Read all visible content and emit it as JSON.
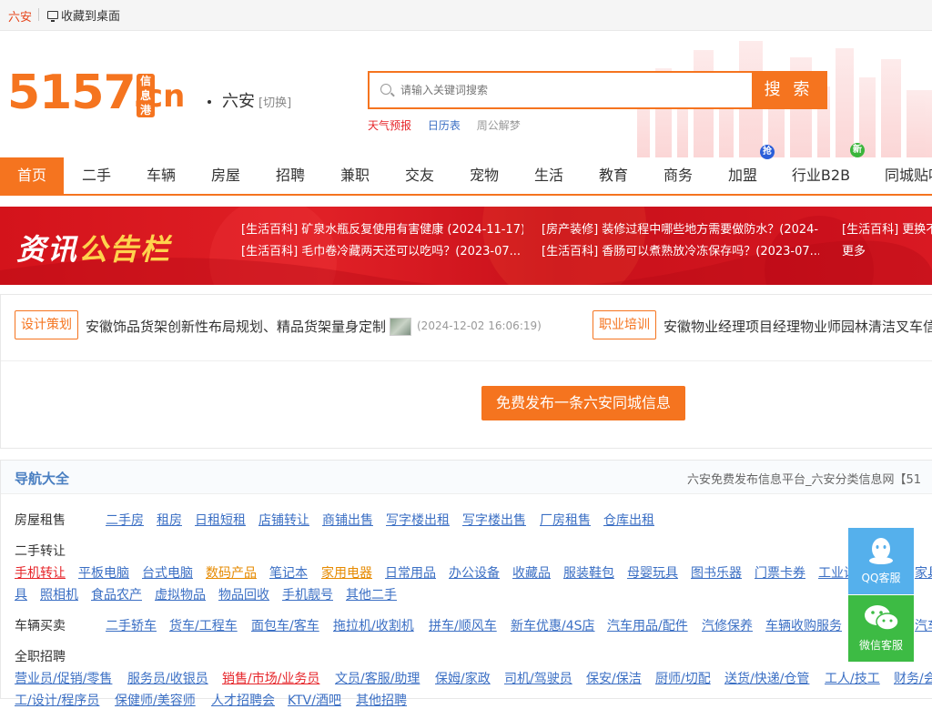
{
  "topbar": {
    "city": "六安",
    "favorite": "收藏到桌面"
  },
  "logo": {
    "number": "5157",
    "suffix": ".cn",
    "badge": "信息港"
  },
  "location": {
    "city": "六安",
    "switch": "[切换]"
  },
  "search": {
    "placeholder": "请输入关键词搜索",
    "button": "搜 索"
  },
  "quick_links": [
    {
      "label": "天气预报",
      "color": "#e6252a"
    },
    {
      "label": "日历表",
      "color": "#3b6fc4"
    },
    {
      "label": "周公解梦",
      "color": "#999999"
    }
  ],
  "nav": {
    "items": [
      "首页",
      "二手",
      "车辆",
      "房屋",
      "招聘",
      "兼职",
      "交友",
      "宠物",
      "生活",
      "教育",
      "商务",
      "加盟",
      "行业B2B",
      "同城贴吧"
    ],
    "tags": {
      "pin": "抢",
      "new": "新"
    }
  },
  "banner": {
    "title_a": "资讯",
    "title_b": "公告栏",
    "news": [
      "[生活百科] 矿泉水瓶反复使用有害健康 (2024-11-17)",
      "[房产装修] 装修过程中哪些地方需要做防水？(2024-...",
      "[生活百科] 更换不",
      "[生活百科] 毛巾卷冷藏两天还可以吃吗？(2023-07...",
      "[生活百科] 香肠可以煮熟放冷冻保存吗？(2023-07...",
      "更多"
    ]
  },
  "ads": [
    {
      "tag": "设计策划",
      "text": "安徽饰品货架创新性布局规划、精品货架量身定制",
      "date": "(2024-12-02 16:06:19)"
    },
    {
      "tag": "职业培训",
      "text": "安徽物业经理项目经理物业师园林清洁叉车信"
    }
  ],
  "publish_button": "免费发布一条六安同城信息",
  "nav_all": {
    "title": "导航大全",
    "subtitle": "六安免费发布信息平台_六安分类信息网【51",
    "rows": [
      {
        "cat": "房屋租售",
        "links": [
          "二手房",
          "租房",
          "日租短租",
          "店铺转让",
          "商铺出售",
          "写字楼出租",
          "写字楼出售",
          "厂房租售",
          "仓库出租"
        ]
      },
      {
        "cat": "二手转让",
        "links": [
          "手机转让",
          "平板电脑",
          "台式电脑",
          "数码产品",
          "笔记本",
          "家用电器",
          "日常用品",
          "办公设备",
          "收藏品",
          "服装鞋包",
          "母婴玩具",
          "图书乐器",
          "门票卡券",
          "工业设",
          "家具",
          "具",
          "照相机",
          "食品农产",
          "虚拟物品",
          "物品回收",
          "手机靓号",
          "其他二手"
        ]
      },
      {
        "cat": "车辆买卖",
        "links": [
          "二手轿车",
          "货车/工程车",
          "面包车/客车",
          "拖拉机/收割机",
          "拼车/顺风车",
          "新车优惠/4S店",
          "汽车用品/配件",
          "汽修保养",
          "车辆收购服务",
          "汽车"
        ]
      },
      {
        "cat": "全职招聘",
        "links": [
          "营业员/促销/零售",
          "服务员/收银员",
          "销售/市场/业务员",
          "文员/客服/助理",
          "保姆/家政",
          "司机/驾驶员",
          "保安/保洁",
          "厨师/切配",
          "送货/快递/仓管",
          "工人/技工",
          "财务/会",
          "工/设计/程序员",
          "保健师/美容师",
          "人才招聘会",
          "KTV/酒吧",
          "其他招聘"
        ]
      }
    ]
  },
  "side": {
    "qq": "QQ客服",
    "wechat": "微信客服"
  },
  "colors": {
    "brand": "#f5741f",
    "link": "#3b6fc4",
    "red": "#e6252a"
  }
}
